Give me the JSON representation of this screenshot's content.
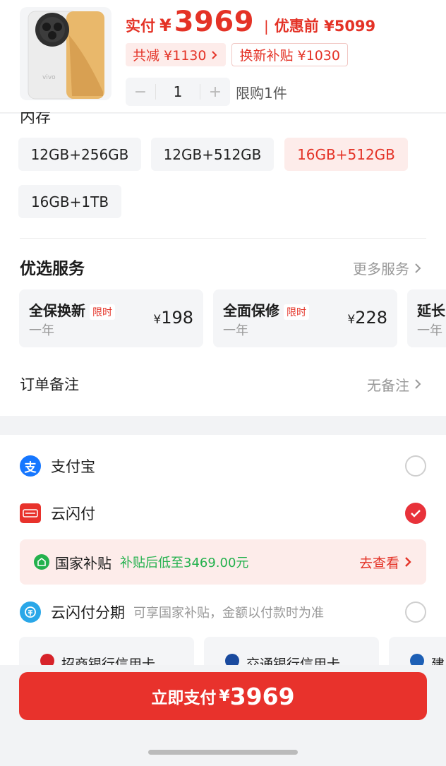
{
  "header": {
    "price_label": "实付",
    "currency": "¥",
    "price": "3969",
    "separator": "|",
    "original_label": "优惠前 ¥5099",
    "discount_chip": "共减 ¥1130",
    "tradein_chip": "换新补贴 ¥1030",
    "quantity": "1",
    "qty_minus": "−",
    "qty_plus": "+",
    "limit_text": "限购1件",
    "product_brand": "vivo"
  },
  "options": {
    "section_title_cut": "内存",
    "memory": [
      {
        "label": "12GB+256GB",
        "selected": false
      },
      {
        "label": "12GB+512GB",
        "selected": false
      },
      {
        "label": "16GB+512GB",
        "selected": true
      },
      {
        "label": "16GB+1TB",
        "selected": false
      }
    ]
  },
  "services": {
    "title": "优选服务",
    "more": "更多服务",
    "cards": [
      {
        "name": "全保换新",
        "tag": "限时",
        "term": "一年",
        "currency": "¥",
        "price": "198"
      },
      {
        "name": "全面保修",
        "tag": "限时",
        "term": "一年",
        "currency": "¥",
        "price": "228"
      },
      {
        "name": "延长",
        "tag": "",
        "term": "一年",
        "currency": "",
        "price": ""
      }
    ]
  },
  "note": {
    "label": "订单备注",
    "value": "无备注"
  },
  "payment": {
    "alipay": {
      "name": "支付宝",
      "selected": false
    },
    "unionpay": {
      "name": "云闪付",
      "selected": true
    },
    "subsidy": {
      "title": "国家补贴",
      "desc": "补贴后低至3469.00元",
      "link": "去查看"
    },
    "installment": {
      "name": "云闪付分期",
      "desc": "可享国家补贴，金额以付款时为准",
      "selected": false
    },
    "banks": [
      "招商银行信用卡",
      "交通银行信用卡",
      "建"
    ]
  },
  "footer": {
    "pay_label": "立即支付",
    "currency": "¥",
    "amount": "3969"
  },
  "colors": {
    "accent": "#e43226",
    "green": "#23b14d",
    "pay_button": "#e8322c"
  }
}
